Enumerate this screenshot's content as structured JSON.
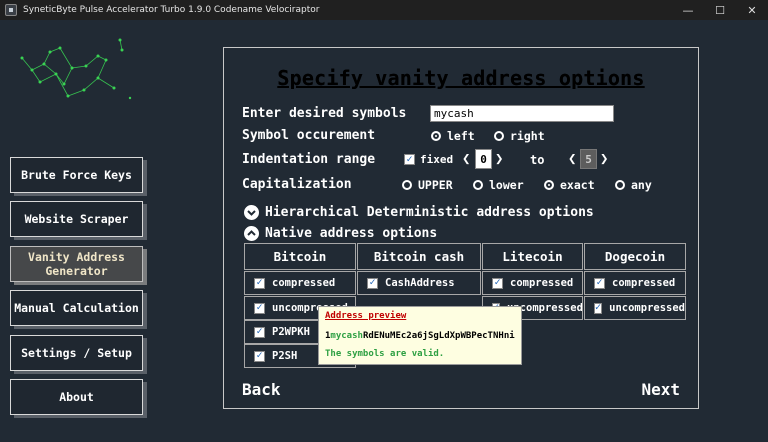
{
  "window": {
    "title": "SyneticByte Pulse Accelerator Turbo 1.9.0 Codename Velociraptor",
    "controls": [
      "—",
      "☐",
      "✕"
    ]
  },
  "sidebar": {
    "items": [
      {
        "label": "Brute Force Keys"
      },
      {
        "label": "Website Scraper"
      },
      {
        "label": "Vanity Address Generator",
        "active": true
      },
      {
        "label": "Manual Calculation"
      },
      {
        "label": "Settings / Setup"
      },
      {
        "label": "About"
      }
    ]
  },
  "main": {
    "heading": "Specify vanity address options",
    "symbols_label": "Enter desired symbols",
    "symbols_value": "mycash",
    "occurrence_label": "Symbol occurement",
    "occurrence_options": [
      "left",
      "right"
    ],
    "occurrence_selected": "left",
    "indentation_label": "Indentation range",
    "fixed_label": "fixed",
    "fixed_checked": true,
    "range_from": "0",
    "range_to_label": "to",
    "range_to": "5",
    "capitalization_label": "Capitalization",
    "cap_options": [
      "UPPER",
      "lower",
      "exact",
      "any"
    ],
    "cap_selected": "exact",
    "hd_label": "Hierarchical Deterministic address options",
    "native_label": "Native address options",
    "columns": [
      "Bitcoin",
      "Bitcoin cash",
      "Litecoin",
      "Dogecoin"
    ],
    "bitcoin": [
      "compressed",
      "uncompressed",
      "P2WPKH",
      "P2SH"
    ],
    "bitcoin_cash": [
      "CashAddress"
    ],
    "litecoin": [
      "compressed",
      "uncompressed"
    ],
    "dogecoin": [
      "compressed",
      "uncompressed"
    ],
    "back_label": "Back",
    "next_label": "Next"
  },
  "tooltip": {
    "title": "Address preview",
    "address_prefix": "1",
    "address_symbols": "mycash",
    "address_rest": "RdENuMEc2a6jSgLdXpWBPecTNHni",
    "status": "The symbols are valid."
  },
  "colors": {
    "background": "#212a34",
    "valid_green": "#2ea043",
    "preview_red": "#c00000",
    "constellation": "#39d353"
  }
}
